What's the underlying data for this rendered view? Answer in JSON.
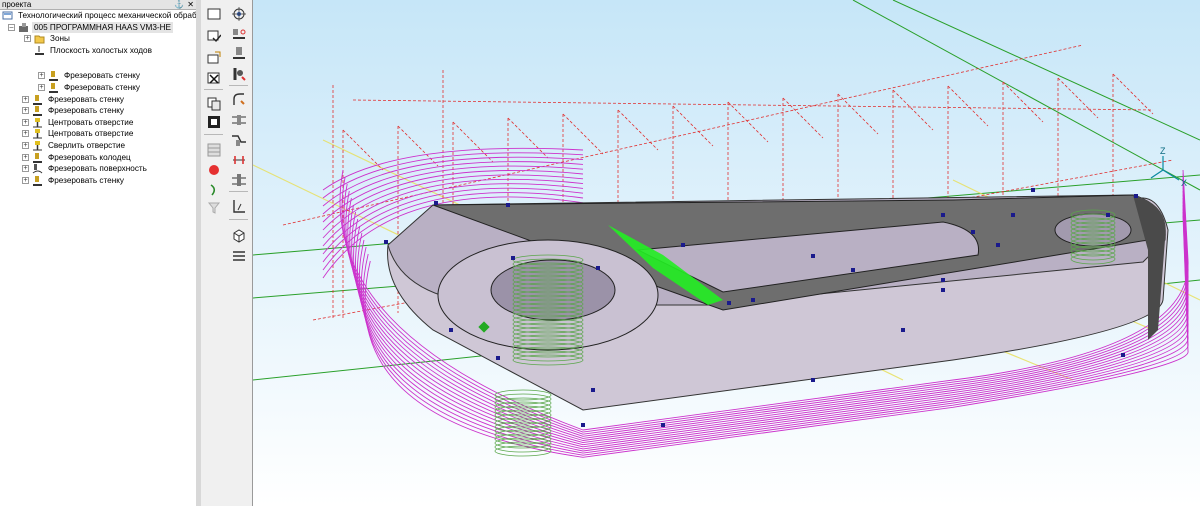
{
  "panel": {
    "title": "проекта",
    "root_label": "Технологический процесс механической обработки",
    "program_label": "005  ПРОГРАММНАЯ HAAS VM3-HE",
    "items": [
      {
        "label": "Зоны"
      },
      {
        "label": "Плоскость холостых ходов"
      },
      {
        "label": "Фрезеровать стенку"
      },
      {
        "label": "Фрезеровать стенку"
      },
      {
        "label": "Фрезеровать стенку"
      },
      {
        "label": "Фрезеровать стенку"
      },
      {
        "label": "Центровать отверстие"
      },
      {
        "label": "Центровать отверстие"
      },
      {
        "label": "Сверлить отверстие"
      },
      {
        "label": "Фрезеровать колодец"
      },
      {
        "label": "Фрезеровать поверхность"
      },
      {
        "label": "Фрезеровать стенку"
      }
    ]
  },
  "toolbars": {
    "left": [
      "new-view-icon",
      "check-view-icon",
      "layer-add-icon",
      "delete-view-icon",
      "copy-icon",
      "paste-icon",
      "grid-icon",
      "record-icon",
      "arrow-icon",
      "filter-icon"
    ],
    "right": [
      "target-icon",
      "plane-icon",
      "fillet-icon",
      "knife-icon",
      "arc-tool-icon",
      "offset-icon",
      "bend-icon",
      "measure-icon",
      "split-icon",
      "dimension-icon",
      "cube-icon",
      "list-icon"
    ]
  },
  "viewport": {
    "triad": {
      "z": "Z",
      "x": "X"
    },
    "colors": {
      "background": "#c6e6f8",
      "toolpath": "#cc33cc",
      "rapid": "#e03030",
      "part": "#cfc7d6",
      "top_face": "#6e6e6e",
      "drill": "#5aa64a",
      "highlight": "#22ee22"
    }
  }
}
